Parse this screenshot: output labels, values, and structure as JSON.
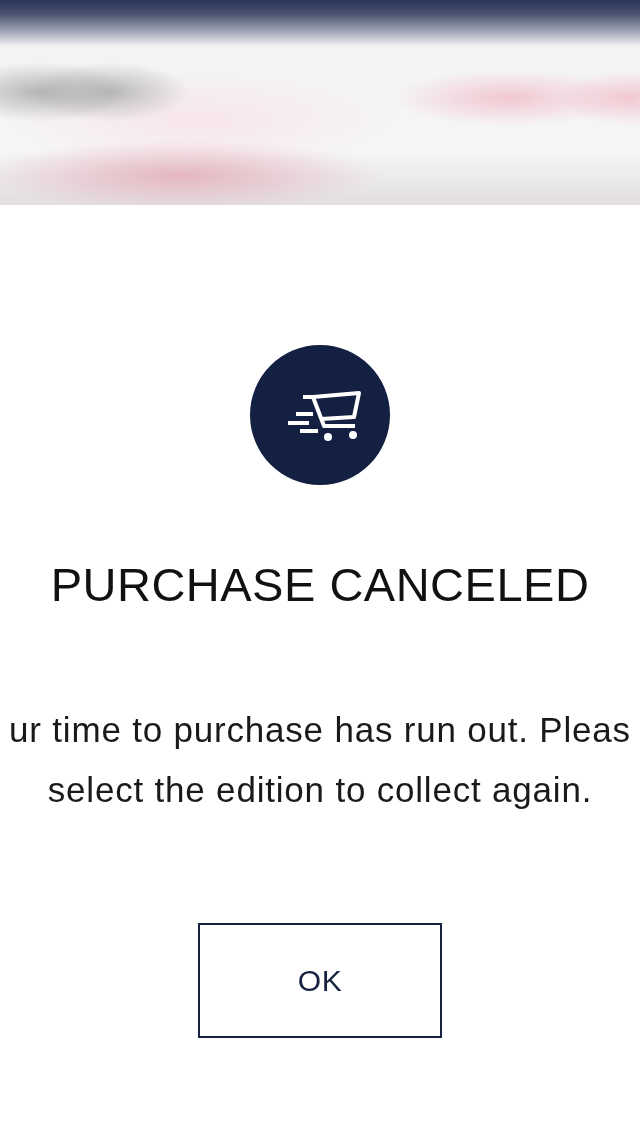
{
  "dialog": {
    "title": "PURCHASE CANCELED",
    "message_lines": [
      "ur time to purchase has run out. Pleas",
      "select the edition to collect again."
    ],
    "buttons": [
      {
        "label": "OK"
      }
    ]
  }
}
